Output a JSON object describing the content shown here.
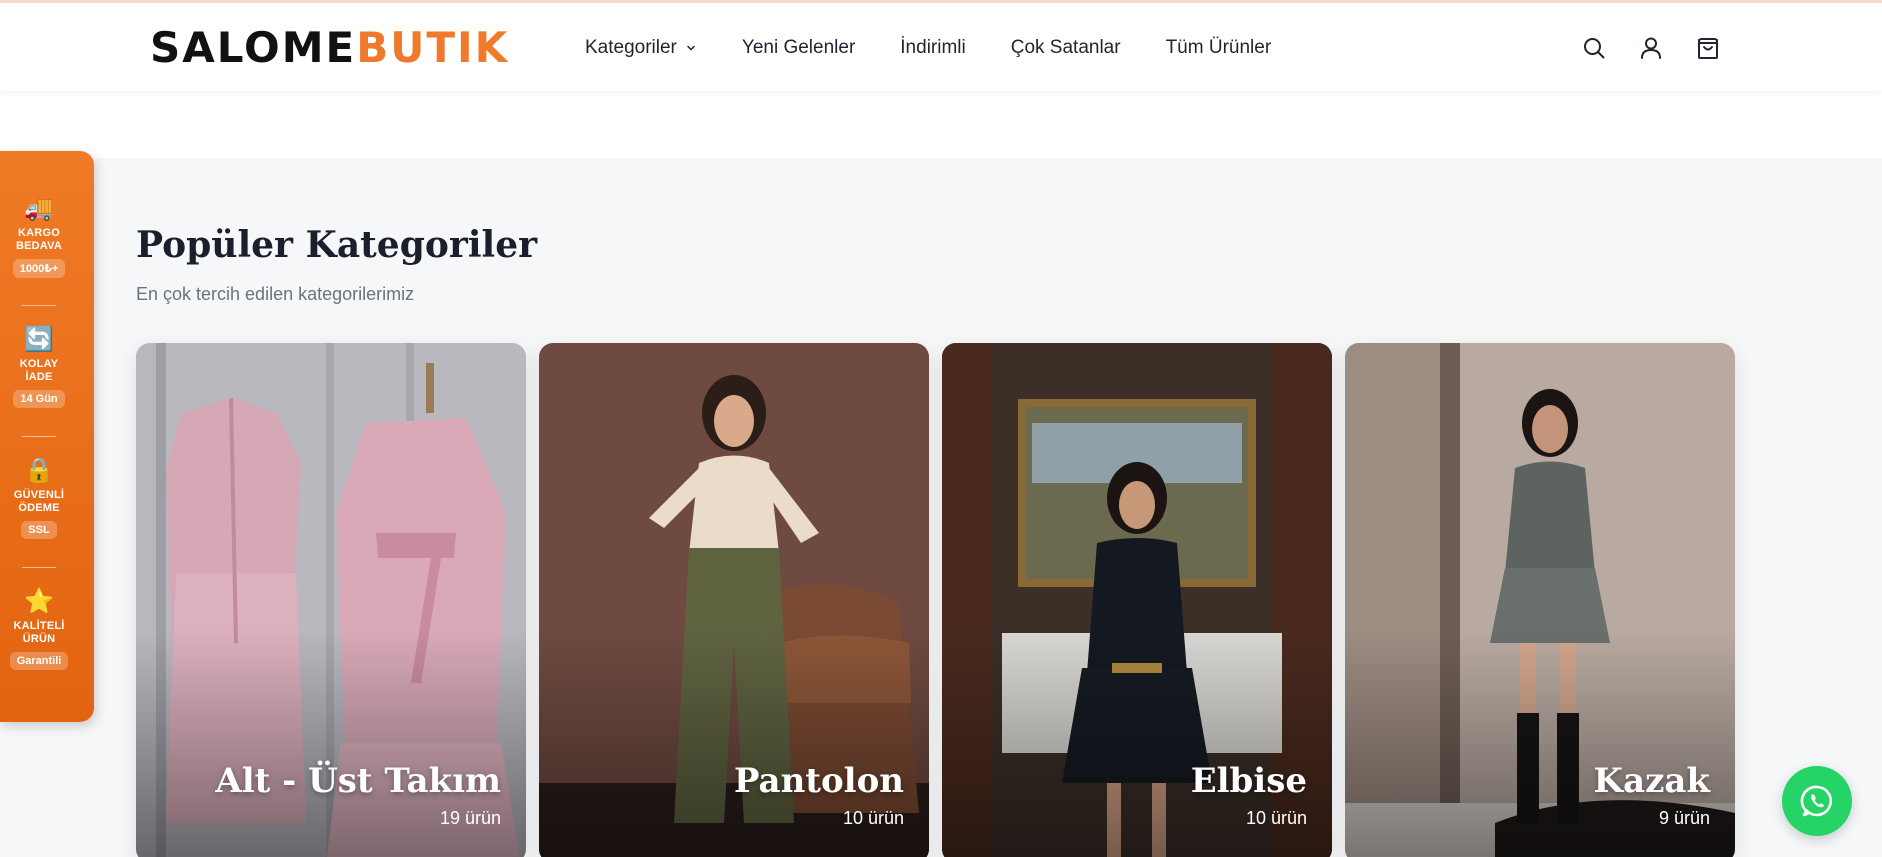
{
  "brand": {
    "part1": "SALOME",
    "part2": "BUTIK",
    "accent": "#ef7a2c"
  },
  "nav": {
    "items": [
      {
        "label": "Kategoriler",
        "has_dropdown": true
      },
      {
        "label": "Yeni Gelenler"
      },
      {
        "label": "İndirimli"
      },
      {
        "label": "Çok Satanlar"
      },
      {
        "label": "Tüm Ürünler"
      }
    ]
  },
  "header_icons": [
    "search-icon",
    "user-icon",
    "cart-icon"
  ],
  "badges": [
    {
      "icon": "truck-icon",
      "glyph": "🚚",
      "label_line1": "KARGO",
      "label_line2": "BEDAVA",
      "pill": "1000₺+"
    },
    {
      "icon": "return-icon",
      "glyph": "🔄",
      "label_line1": "KOLAY",
      "label_line2": "İADE",
      "pill": "14 Gün"
    },
    {
      "icon": "lock-icon",
      "glyph": "🔒",
      "label_line1": "GÜVENLİ",
      "label_line2": "ÖDEME",
      "pill": "SSL"
    },
    {
      "icon": "star-icon",
      "glyph": "⭐",
      "label_line1": "KALİTELİ",
      "label_line2": "ÜRÜN",
      "pill": "Garantili"
    }
  ],
  "section": {
    "title": "Popüler Kategoriler",
    "subtitle": "En çok tercih edilen kategorilerimiz"
  },
  "categories": [
    {
      "name": "Alt - Üst Takım",
      "count": "19 ürün"
    },
    {
      "name": "Pantolon",
      "count": "10 ürün"
    },
    {
      "name": "Elbise",
      "count": "10 ürün"
    },
    {
      "name": "Kazak",
      "count": "9 ürün"
    }
  ],
  "floating": {
    "icon": "whatsapp-icon",
    "color": "#25d366"
  }
}
